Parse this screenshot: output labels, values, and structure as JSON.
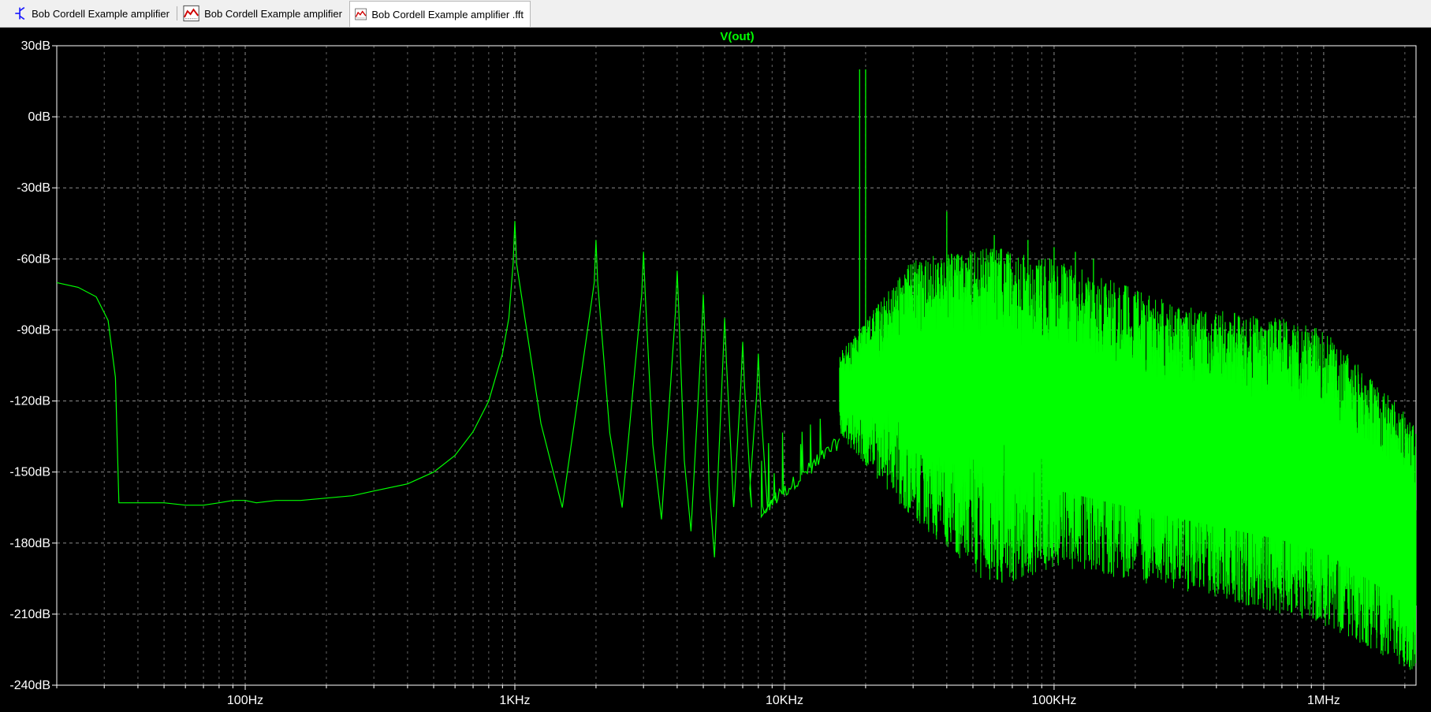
{
  "tabs": [
    {
      "label": "Bob Cordell Example amplifier",
      "icon": "schematic-icon",
      "active": false
    },
    {
      "label": "Bob Cordell Example amplifier",
      "icon": "waveform-icon",
      "active": false
    },
    {
      "label": "Bob Cordell Example amplifier .fft",
      "icon": "waveform-icon",
      "active": true
    }
  ],
  "colors": {
    "background": "#000000",
    "trace": "#00ff00",
    "grid": "#8a8a8a",
    "text": "#ffffff"
  },
  "chart_data": {
    "type": "line",
    "title": "V(out)",
    "xlabel": "",
    "ylabel": "",
    "x_scale": "log",
    "xlim": [
      20,
      2200000
    ],
    "ylim": [
      -240,
      30
    ],
    "grid": true,
    "y_ticks": [
      30,
      0,
      -30,
      -60,
      -90,
      -120,
      -150,
      -180,
      -210,
      -240
    ],
    "y_tick_labels": [
      "30dB",
      "0dB",
      "-30dB",
      "-60dB",
      "-90dB",
      "-120dB",
      "-150dB",
      "-180dB",
      "-210dB",
      "-240dB"
    ],
    "x_ticks": [
      100,
      1000,
      10000,
      100000,
      1000000
    ],
    "x_tick_labels": [
      "100Hz",
      "1KHz",
      "10KHz",
      "100KHz",
      "1MHz"
    ],
    "series": [
      {
        "name": "V(out)",
        "baseline": [
          [
            20,
            -70
          ],
          [
            24,
            -72
          ],
          [
            28,
            -76
          ],
          [
            31,
            -86
          ],
          [
            33,
            -110
          ],
          [
            34,
            -163
          ],
          [
            40,
            -163
          ],
          [
            50,
            -163
          ],
          [
            60,
            -164
          ],
          [
            70,
            -164
          ],
          [
            80,
            -163
          ],
          [
            90,
            -162
          ],
          [
            100,
            -162
          ],
          [
            110,
            -163
          ],
          [
            130,
            -162
          ],
          [
            160,
            -162
          ],
          [
            200,
            -161
          ],
          [
            250,
            -160
          ],
          [
            300,
            -158
          ],
          [
            400,
            -155
          ],
          [
            500,
            -150
          ],
          [
            600,
            -143
          ],
          [
            700,
            -133
          ],
          [
            800,
            -120
          ],
          [
            900,
            -100
          ],
          [
            950,
            -85
          ]
        ],
        "peaks": [
          {
            "f": 1000,
            "db": -44
          },
          {
            "f": 2000,
            "db": -52
          },
          {
            "f": 3000,
            "db": -57
          },
          {
            "f": 4000,
            "db": -65
          },
          {
            "f": 5000,
            "db": -75
          },
          {
            "f": 6000,
            "db": -85
          },
          {
            "f": 7000,
            "db": -95
          },
          {
            "f": 8000,
            "db": -100
          },
          {
            "f": 19000,
            "db": 20
          },
          {
            "f": 20000,
            "db": 20
          },
          {
            "f": 40000,
            "db": -40
          },
          {
            "f": 60000,
            "db": -50
          },
          {
            "f": 80000,
            "db": -52
          },
          {
            "f": 100000,
            "db": -55
          },
          {
            "f": 120000,
            "db": -57
          },
          {
            "f": 140000,
            "db": -60
          }
        ],
        "troughs": [
          {
            "f": 1500,
            "db": -165
          },
          {
            "f": 2500,
            "db": -165
          },
          {
            "f": 3500,
            "db": -170
          },
          {
            "f": 4500,
            "db": -175
          },
          {
            "f": 5500,
            "db": -186
          }
        ],
        "dense_band": {
          "f_start": 16000,
          "f_end": 2200000,
          "upper_envelope": [
            [
              16000,
              -100
            ],
            [
              30000,
              -60
            ],
            [
              60000,
              -55
            ],
            [
              100000,
              -60
            ],
            [
              300000,
              -80
            ],
            [
              700000,
              -85
            ],
            [
              1000000,
              -90
            ],
            [
              1500000,
              -110
            ],
            [
              2200000,
              -130
            ]
          ],
          "lower_envelope": [
            [
              16000,
              -135
            ],
            [
              30000,
              -170
            ],
            [
              60000,
              -200
            ],
            [
              100000,
              -190
            ],
            [
              300000,
              -200
            ],
            [
              700000,
              -210
            ],
            [
              1000000,
              -215
            ],
            [
              1500000,
              -225
            ],
            [
              2200000,
              -235
            ]
          ]
        }
      }
    ]
  }
}
